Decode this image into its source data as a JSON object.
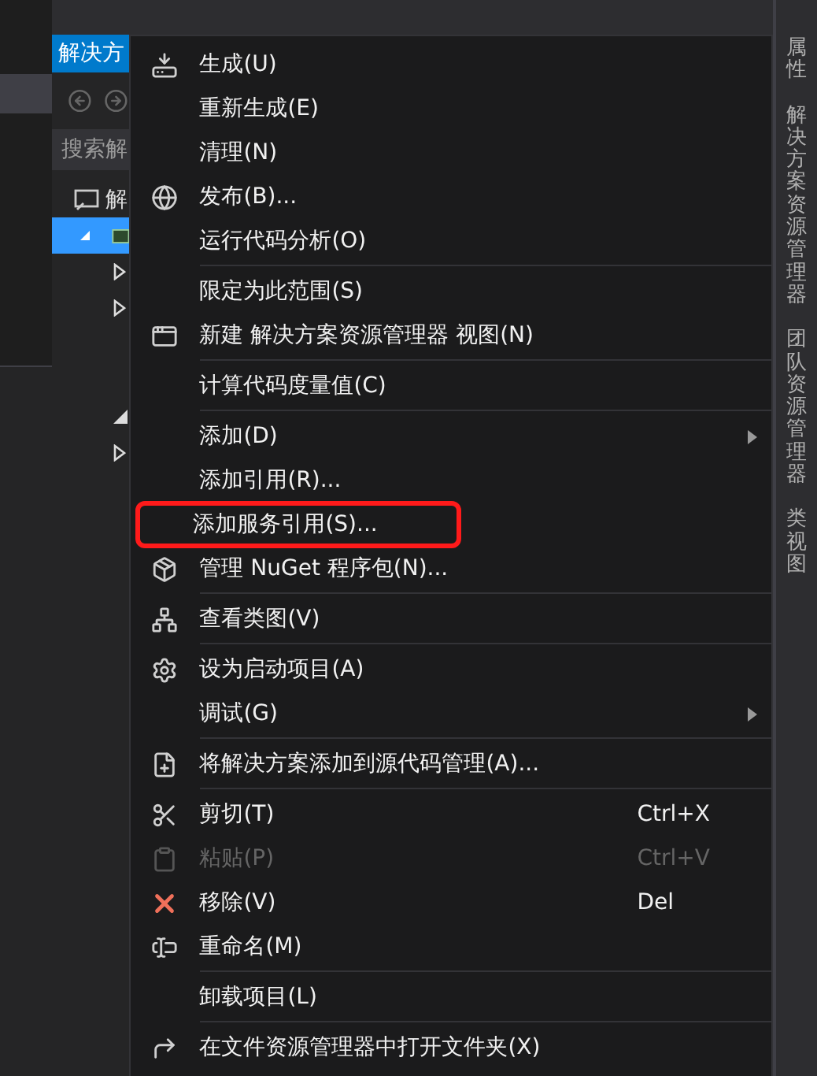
{
  "explorer": {
    "title": "解决方",
    "search": {
      "placeholder": "搜索解"
    },
    "tree": [
      {
        "label": "解",
        "selected": false,
        "children": [
          {
            "selected": true,
            "expanded": true,
            "children": [
              {
                "kind": "folder",
                "expanded": false
              },
              {
                "kind": "folder",
                "expanded": false
              },
              {
                "kind": "leaf"
              },
              {
                "kind": "leaf"
              },
              {
                "kind": "folder",
                "expanded": true
              },
              {
                "kind": "folder",
                "expanded": false
              }
            ]
          }
        ]
      }
    ]
  },
  "context_menu": [
    {
      "kind": "item",
      "label": "生成(U)"
    },
    {
      "kind": "item",
      "label": "重新生成(E)"
    },
    {
      "kind": "item",
      "label": "清理(N)"
    },
    {
      "kind": "item",
      "label": "发布(B)..."
    },
    {
      "kind": "item",
      "label": "运行代码分析(O)"
    },
    {
      "kind": "separator"
    },
    {
      "kind": "item",
      "label": "限定为此范围(S)"
    },
    {
      "kind": "item",
      "label": "新建 解决方案资源管理器 视图(N)"
    },
    {
      "kind": "separator"
    },
    {
      "kind": "item",
      "label": "计算代码度量值(C)"
    },
    {
      "kind": "separator"
    },
    {
      "kind": "item",
      "label": "添加(D)",
      "submenu": true
    },
    {
      "kind": "item",
      "label": "添加引用(R)..."
    },
    {
      "kind": "item",
      "label": "添加服务引用(S)...",
      "highlighted": true
    },
    {
      "kind": "item",
      "label": "管理 NuGet 程序包(N)..."
    },
    {
      "kind": "separator"
    },
    {
      "kind": "item",
      "label": "查看类图(V)"
    },
    {
      "kind": "separator"
    },
    {
      "kind": "item",
      "label": "设为启动项目(A)"
    },
    {
      "kind": "item",
      "label": "调试(G)",
      "submenu": true
    },
    {
      "kind": "separator"
    },
    {
      "kind": "item",
      "label": "将解决方案添加到源代码管理(A)..."
    },
    {
      "kind": "separator"
    },
    {
      "kind": "item",
      "label": "剪切(T)",
      "shortcut": "Ctrl+X"
    },
    {
      "kind": "item",
      "label": "粘贴(P)",
      "shortcut": "Ctrl+V",
      "disabled": true
    },
    {
      "kind": "item",
      "label": "移除(V)",
      "shortcut": "Del"
    },
    {
      "kind": "item",
      "label": "重命名(M)"
    },
    {
      "kind": "separator"
    },
    {
      "kind": "item",
      "label": "卸载项目(L)"
    },
    {
      "kind": "separator"
    },
    {
      "kind": "item",
      "label": "在文件资源管理器中打开文件夹(X)"
    }
  ],
  "side_tabs": [
    {
      "label": "属性"
    },
    {
      "label": "解决方案资源管理器"
    },
    {
      "label": "团队资源管理器"
    },
    {
      "label": "类视图"
    }
  ]
}
